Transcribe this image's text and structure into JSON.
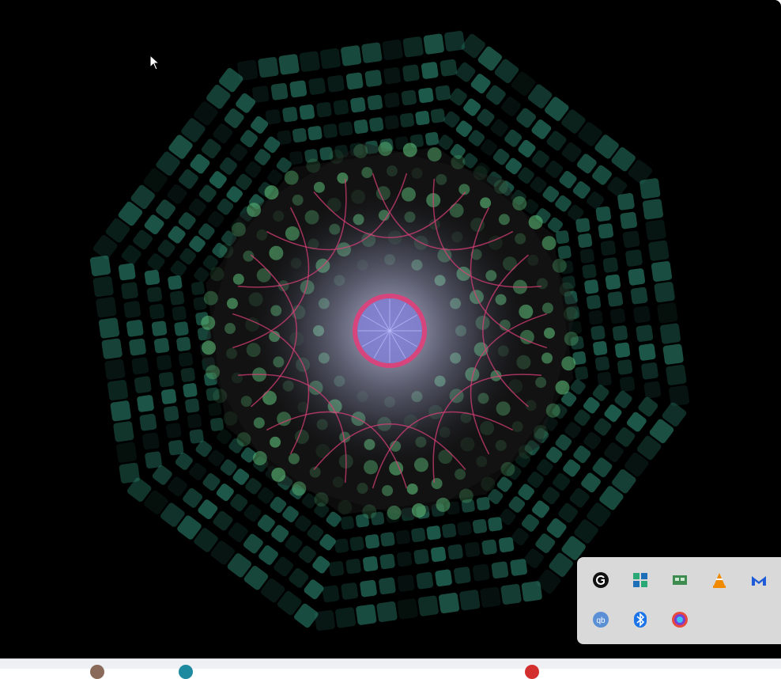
{
  "screen": {
    "background": "#000000",
    "visualizer": {
      "name": "octagonal-mandala-visualizer",
      "primary_color": "#2f8f78",
      "accent_color": "#e0407a",
      "glow_color": "#d8d8ff"
    }
  },
  "tray": {
    "icons": [
      {
        "name": "grammarly-icon",
        "color": "#111111"
      },
      {
        "name": "green-puzzle-app-icon",
        "color": "#2aa876"
      },
      {
        "name": "network-card-icon",
        "color": "#3d8b4f"
      },
      {
        "name": "vlc-icon",
        "color": "#f08a00"
      },
      {
        "name": "malwarebytes-icon",
        "color": "#1e5bd8"
      },
      {
        "name": "qbittorrent-icon",
        "color": "#5b8fd6"
      },
      {
        "name": "bluetooth-icon",
        "color": "#1a73e8"
      },
      {
        "name": "edge-canary-icon",
        "color": "#7a3fd1"
      }
    ]
  },
  "taskbar": {
    "visible_items": [
      {
        "name": "taskbar-app-1",
        "color": "#8a6a5a"
      },
      {
        "name": "taskbar-app-2",
        "color": "#1e8aa0"
      },
      {
        "name": "taskbar-app-3",
        "color": "#d32f2f"
      }
    ]
  }
}
